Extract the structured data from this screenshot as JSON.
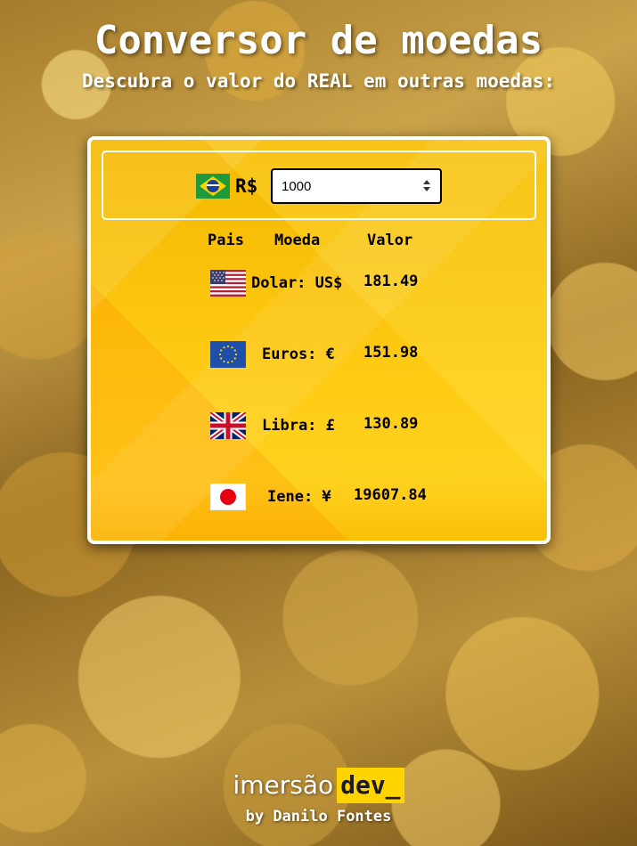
{
  "header": {
    "title": "Conversor de moedas",
    "subtitle": "Descubra o valor do REAL em outras moedas:"
  },
  "converter": {
    "base_currency": "R$",
    "amount_value": "1000",
    "columns": {
      "country": "Pais",
      "currency": "Moeda",
      "value": "Valor"
    },
    "rows": [
      {
        "flag": "usa-flag-icon",
        "label": "Dolar: US$",
        "value": "181.49"
      },
      {
        "flag": "eu-flag-icon",
        "label": "Euros: €",
        "value": "151.98"
      },
      {
        "flag": "uk-flag-icon",
        "label": "Libra: £",
        "value": "130.89"
      },
      {
        "flag": "japan-flag-icon",
        "label": "Iene: ¥",
        "value": "19607.84"
      }
    ]
  },
  "footer": {
    "brand_part1": "imersão",
    "brand_part2": "dev_",
    "byline": "by Danilo Fontes"
  }
}
